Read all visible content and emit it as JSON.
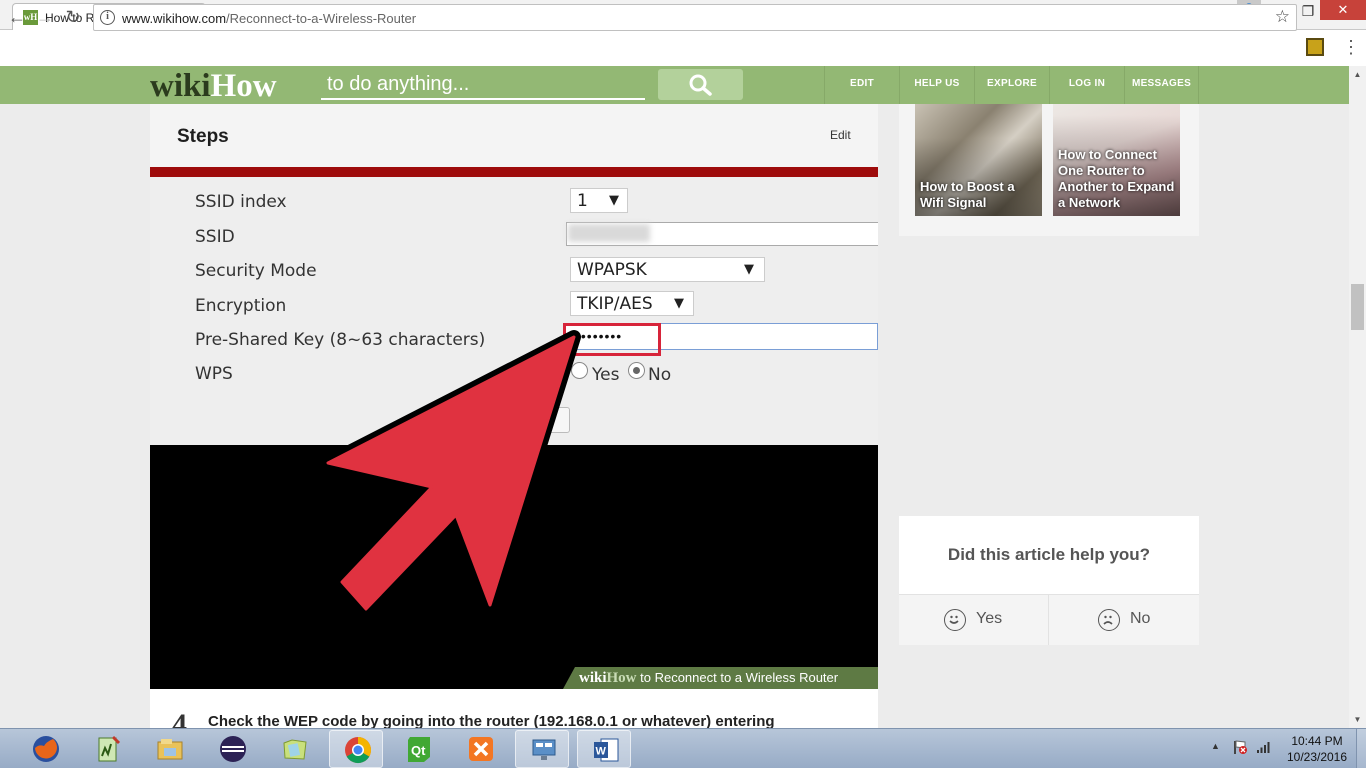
{
  "browser": {
    "tab_title": "How to Reconnect to a W",
    "tab_favicon": "wH",
    "url_domain": "www.wikihow.com",
    "url_path": "/Reconnect-to-a-Wireless-Router"
  },
  "wikihow": {
    "logo_wiki": "wiki",
    "logo_how": "How",
    "search_placeholder": "to do anything...",
    "nav": [
      "EDIT",
      "HELP US",
      "EXPLORE",
      "LOG IN",
      "MESSAGES"
    ],
    "brand_color": "#93b874"
  },
  "article": {
    "section_title": "Steps",
    "edit_label": "Edit",
    "router_labels": [
      "SSID index",
      "SSID",
      "Security Mode",
      "Encryption",
      "Pre-Shared Key (8~63 characters)",
      "WPS"
    ],
    "ssid_index_value": "1",
    "security_mode_value": "WPAPSK",
    "encryption_value": "TKIP/AES",
    "psk_value": "••••••••",
    "wps_yes": "Yes",
    "wps_no": "No",
    "caption_logo_wiki": "wiki",
    "caption_logo_how": "How",
    "caption_text": " to Reconnect to a Wireless Router",
    "next_step_number": "4",
    "next_step_text": "Check the WEP code by going into the router (192.168.0.1 or whatever) entering"
  },
  "sidebar": {
    "related": [
      "How to Boost a Wifi Signal",
      "How to Connect One Router to Another to Expand a Network"
    ],
    "help_question": "Did this article help you?",
    "help_yes": "Yes",
    "help_no": "No"
  },
  "taskbar": {
    "apps": [
      "firefox-icon",
      "notepad-icon",
      "file-explorer-icon",
      "eclipse-icon",
      "folder-icon",
      "chrome-icon",
      "qt-creator-icon",
      "xampp-icon",
      "remote-desktop-icon",
      "word-icon"
    ],
    "time": "10:44 PM",
    "date": "10/23/2016"
  }
}
